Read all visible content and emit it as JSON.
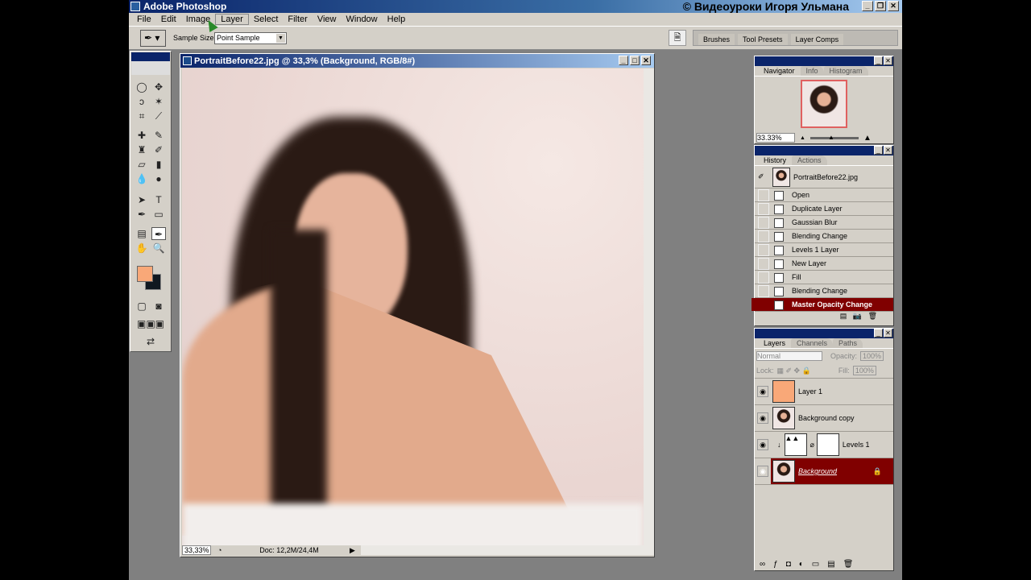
{
  "app": {
    "title": "Adobe Photoshop",
    "watermark": "© Видеоуроки Игоря Ульмана"
  },
  "menu": [
    "File",
    "Edit",
    "Image",
    "Layer",
    "Select",
    "Filter",
    "View",
    "Window",
    "Help"
  ],
  "options": {
    "sample_size_label": "Sample Size:",
    "sample_size_value": "Point Sample"
  },
  "palette_well": [
    "Brushes",
    "Tool Presets",
    "Layer Comps"
  ],
  "document": {
    "title": "PortraitBefore22.jpg @ 33,3% (Background, RGB/8#)",
    "zoom": "33,33%",
    "doc_info": "Doc: 12,2M/24,4M"
  },
  "colors": {
    "foreground": "#f9a878",
    "background": "#101820",
    "selection": "#800000"
  },
  "navigator": {
    "tabs": [
      "Navigator",
      "Info",
      "Histogram"
    ],
    "zoom": "33.33%"
  },
  "history": {
    "tabs": [
      "History",
      "Actions"
    ],
    "snapshot": "PortraitBefore22.jpg",
    "items": [
      "Open",
      "Duplicate Layer",
      "Gaussian Blur",
      "Blending Change",
      "Levels 1 Layer",
      "New Layer",
      "Fill",
      "Blending Change",
      "Master Opacity Change"
    ],
    "selected": "Master Opacity Change"
  },
  "layers": {
    "tabs": [
      "Layers",
      "Channels",
      "Paths"
    ],
    "blend_mode": "Normal",
    "opacity_label": "Opacity:",
    "opacity": "100%",
    "lock_label": "Lock:",
    "fill_label": "Fill:",
    "fill": "100%",
    "items": [
      "Layer 1",
      "Background copy",
      "Levels 1",
      "Background"
    ],
    "selected": "Background"
  }
}
